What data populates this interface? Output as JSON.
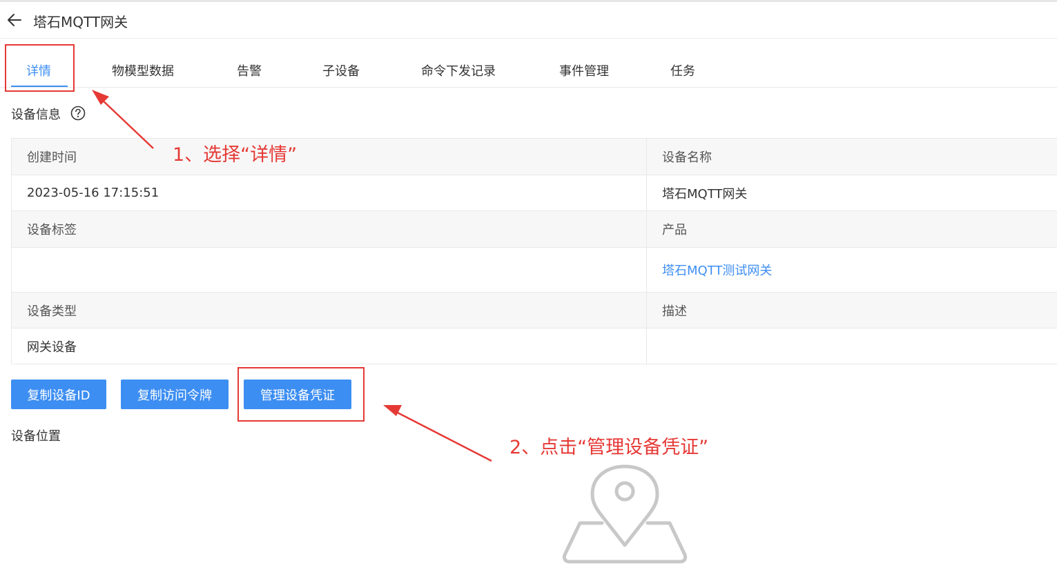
{
  "header": {
    "title": "塔石MQTT网关",
    "back_icon": "arrow-left-icon"
  },
  "tabs": [
    {
      "label": "详情",
      "active": true
    },
    {
      "label": "物模型数据",
      "active": false
    },
    {
      "label": "告警",
      "active": false
    },
    {
      "label": "子设备",
      "active": false
    },
    {
      "label": "命令下发记录",
      "active": false
    },
    {
      "label": "事件管理",
      "active": false
    },
    {
      "label": "任务",
      "active": false
    }
  ],
  "device_info": {
    "section_title": "设备信息",
    "help_icon": "question-circle-icon",
    "fields": {
      "created_time_label": "创建时间",
      "created_time_value": "2023-05-16 17:15:51",
      "device_name_label": "设备名称",
      "device_name_value": "塔石MQTT网关",
      "device_tags_label": "设备标签",
      "device_tags_value": "",
      "product_label": "产品",
      "product_value": "塔石MQTT测试网关",
      "device_type_label": "设备类型",
      "device_type_value": "网关设备",
      "description_label": "描述",
      "description_value": ""
    }
  },
  "actions": {
    "copy_id": "复制设备ID",
    "copy_token": "复制访问令牌",
    "manage_credentials": "管理设备凭证"
  },
  "location": {
    "section_title": "设备位置",
    "empty_icon": "map-pin-icon"
  },
  "annotations": {
    "step1": "1、选择“详情”",
    "step2": "2、点击“管理设备凭证”",
    "color": "#e53935"
  },
  "colors": {
    "primary": "#3d8ef2",
    "annotation_red": "#e53935"
  }
}
